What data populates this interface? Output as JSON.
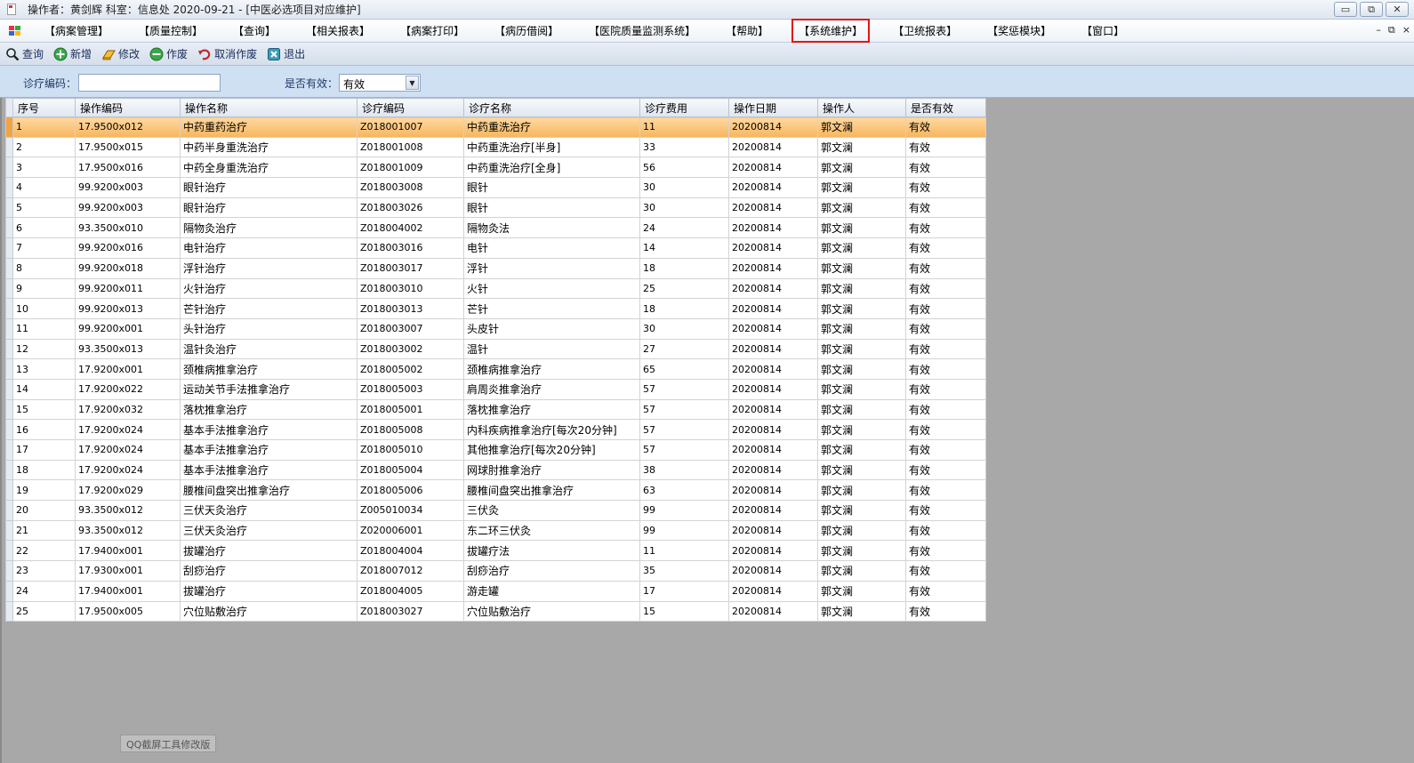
{
  "window": {
    "title": "操作者：黄剑辉  科室：信息处  2020-09-21 - [中医必选项目对应维护]",
    "min_label": "▭",
    "max_label": "⧉",
    "close_label": "✕"
  },
  "menu": {
    "items": [
      "【病案管理】",
      "【质量控制】",
      "【查询】",
      "【相关报表】",
      "【病案打印】",
      "【病历借阅】",
      "【医院质量监测系统】",
      "【帮助】",
      "【系统维护】",
      "【卫统报表】",
      "【奖惩模块】",
      "【窗口】"
    ],
    "highlight_index": 8,
    "mdi_min": "–",
    "mdi_restore": "⧉",
    "mdi_close": "×"
  },
  "toolbar": {
    "query_label": "查询",
    "new_label": "新增",
    "edit_label": "修改",
    "void_label": "作废",
    "unvoid_label": "取消作废",
    "exit_label": "退出"
  },
  "filter": {
    "code_label": "诊疗编码：",
    "code_value": "",
    "valid_label": "是否有效：",
    "valid_value": "有效"
  },
  "grid": {
    "columns": [
      "序号",
      "操作编码",
      "操作名称",
      "诊疗编码",
      "诊疗名称",
      "诊疗费用",
      "操作日期",
      "操作人",
      "是否有效"
    ],
    "selected_row": 0,
    "rows": [
      [
        "1",
        "17.9500x012",
        "中药重药治疗",
        "Z018001007",
        "中药重洗治疗",
        "11",
        "20200814",
        "郭文澜",
        "有效"
      ],
      [
        "2",
        "17.9500x015",
        "中药半身重洗治疗",
        "Z018001008",
        "中药重洗治疗[半身]",
        "33",
        "20200814",
        "郭文澜",
        "有效"
      ],
      [
        "3",
        "17.9500x016",
        "中药全身重洗治疗",
        "Z018001009",
        "中药重洗治疗[全身]",
        "56",
        "20200814",
        "郭文澜",
        "有效"
      ],
      [
        "4",
        "99.9200x003",
        "眼针治疗",
        "Z018003008",
        "眼针",
        "30",
        "20200814",
        "郭文澜",
        "有效"
      ],
      [
        "5",
        "99.9200x003",
        "眼针治疗",
        "Z018003026",
        "眼针",
        "30",
        "20200814",
        "郭文澜",
        "有效"
      ],
      [
        "6",
        "93.3500x010",
        "隔物灸治疗",
        "Z018004002",
        "隔物灸法",
        "24",
        "20200814",
        "郭文澜",
        "有效"
      ],
      [
        "7",
        "99.9200x016",
        "电针治疗",
        "Z018003016",
        "电针",
        "14",
        "20200814",
        "郭文澜",
        "有效"
      ],
      [
        "8",
        "99.9200x018",
        "浮针治疗",
        "Z018003017",
        "浮针",
        "18",
        "20200814",
        "郭文澜",
        "有效"
      ],
      [
        "9",
        "99.9200x011",
        "火针治疗",
        "Z018003010",
        "火针",
        "25",
        "20200814",
        "郭文澜",
        "有效"
      ],
      [
        "10",
        "99.9200x013",
        "芒针治疗",
        "Z018003013",
        "芒针",
        "18",
        "20200814",
        "郭文澜",
        "有效"
      ],
      [
        "11",
        "99.9200x001",
        "头针治疗",
        "Z018003007",
        "头皮针",
        "30",
        "20200814",
        "郭文澜",
        "有效"
      ],
      [
        "12",
        "93.3500x013",
        "温针灸治疗",
        "Z018003002",
        "温针",
        "27",
        "20200814",
        "郭文澜",
        "有效"
      ],
      [
        "13",
        "17.9200x001",
        "颈椎病推拿治疗",
        "Z018005002",
        "颈椎病推拿治疗",
        "65",
        "20200814",
        "郭文澜",
        "有效"
      ],
      [
        "14",
        "17.9200x022",
        "运动关节手法推拿治疗",
        "Z018005003",
        "肩周炎推拿治疗",
        "57",
        "20200814",
        "郭文澜",
        "有效"
      ],
      [
        "15",
        "17.9200x032",
        "落枕推拿治疗",
        "Z018005001",
        "落枕推拿治疗",
        "57",
        "20200814",
        "郭文澜",
        "有效"
      ],
      [
        "16",
        "17.9200x024",
        "基本手法推拿治疗",
        "Z018005008",
        "内科疾病推拿治疗[每次20分钟]",
        "57",
        "20200814",
        "郭文澜",
        "有效"
      ],
      [
        "17",
        "17.9200x024",
        "基本手法推拿治疗",
        "Z018005010",
        "其他推拿治疗[每次20分钟]",
        "57",
        "20200814",
        "郭文澜",
        "有效"
      ],
      [
        "18",
        "17.9200x024",
        "基本手法推拿治疗",
        "Z018005004",
        "网球肘推拿治疗",
        "38",
        "20200814",
        "郭文澜",
        "有效"
      ],
      [
        "19",
        "17.9200x029",
        "腰椎间盘突出推拿治疗",
        "Z018005006",
        "腰椎间盘突出推拿治疗",
        "63",
        "20200814",
        "郭文澜",
        "有效"
      ],
      [
        "20",
        "93.3500x012",
        "三伏天灸治疗",
        "Z005010034",
        "三伏灸",
        "99",
        "20200814",
        "郭文澜",
        "有效"
      ],
      [
        "21",
        "93.3500x012",
        "三伏天灸治疗",
        "Z020006001",
        "东二环三伏灸",
        "99",
        "20200814",
        "郭文澜",
        "有效"
      ],
      [
        "22",
        "17.9400x001",
        "拔罐治疗",
        "Z018004004",
        "拔罐疗法",
        "11",
        "20200814",
        "郭文澜",
        "有效"
      ],
      [
        "23",
        "17.9300x001",
        "刮痧治疗",
        "Z018007012",
        "刮痧治疗",
        "35",
        "20200814",
        "郭文澜",
        "有效"
      ],
      [
        "24",
        "17.9400x001",
        "拔罐治疗",
        "Z018004005",
        "游走罐",
        "17",
        "20200814",
        "郭文澜",
        "有效"
      ],
      [
        "25",
        "17.9500x005",
        "穴位贴敷治疗",
        "Z018003027",
        "穴位贴敷治疗",
        "15",
        "20200814",
        "郭文澜",
        "有效"
      ]
    ]
  },
  "watermark": "QQ截屏工具修改版",
  "colors": {
    "selected_row": "#f7b55c",
    "menu_highlight_border": "#e01515",
    "filter_bar": "#cfe0f3"
  }
}
